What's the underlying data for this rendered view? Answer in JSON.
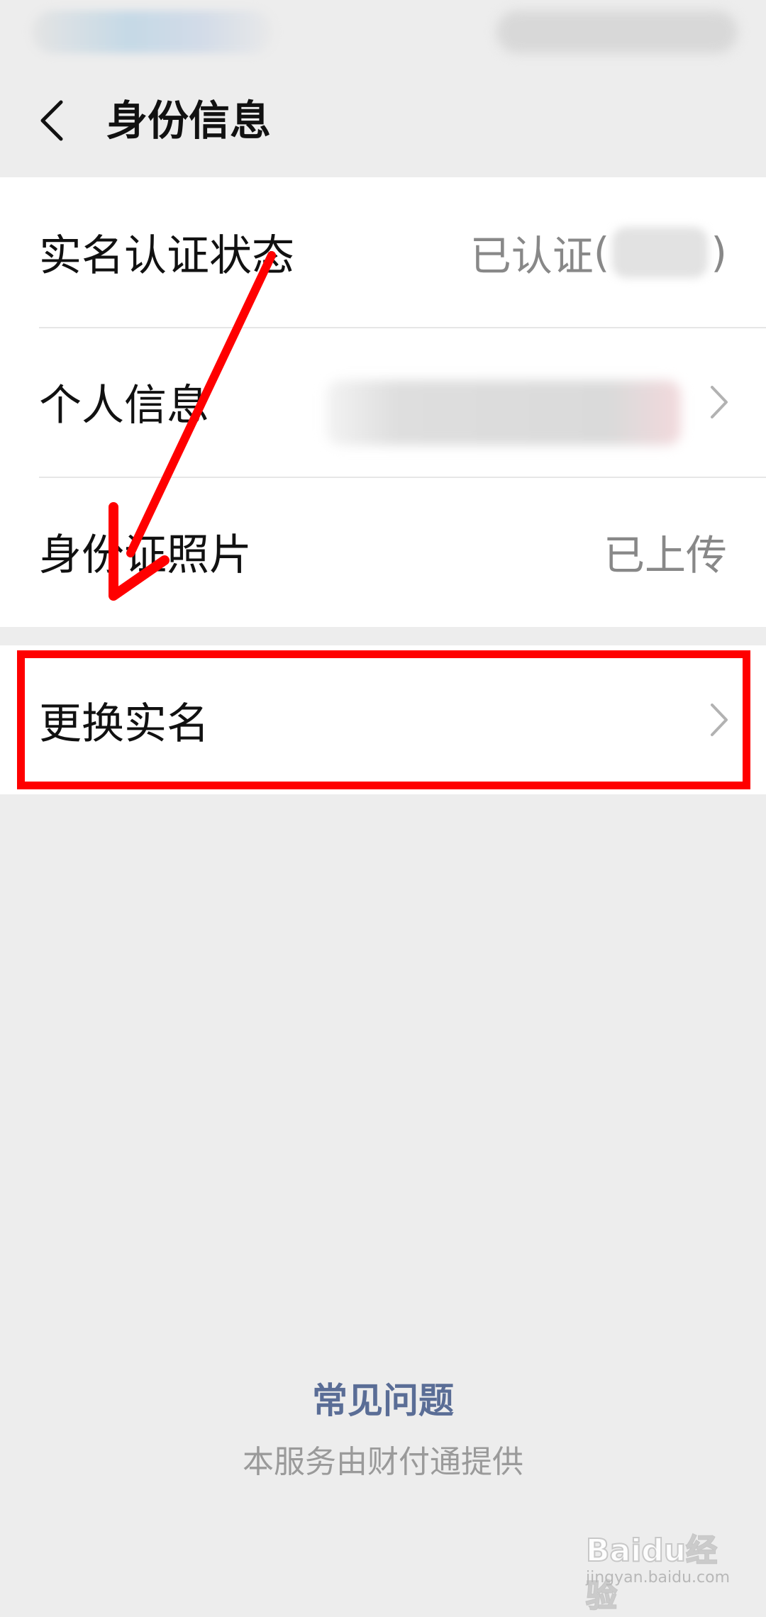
{
  "nav": {
    "title": "身份信息"
  },
  "rows": [
    {
      "label": "实名认证状态",
      "value": "已认证",
      "paren_open": "(",
      "paren_close": ")"
    },
    {
      "label": "个人信息"
    },
    {
      "label": "身份证照片",
      "value": "已上传"
    }
  ],
  "change_row": {
    "label": "更换实名"
  },
  "footer": {
    "faq": "常见问题",
    "note": "本服务由财付通提供"
  },
  "watermark": {
    "brand": "Baidu经验",
    "site": "jingyan.baidu.com"
  },
  "colors": {
    "annotation": "#ff0000",
    "link": "#5a6d96",
    "value_text": "#888888",
    "background": "#ededed"
  }
}
